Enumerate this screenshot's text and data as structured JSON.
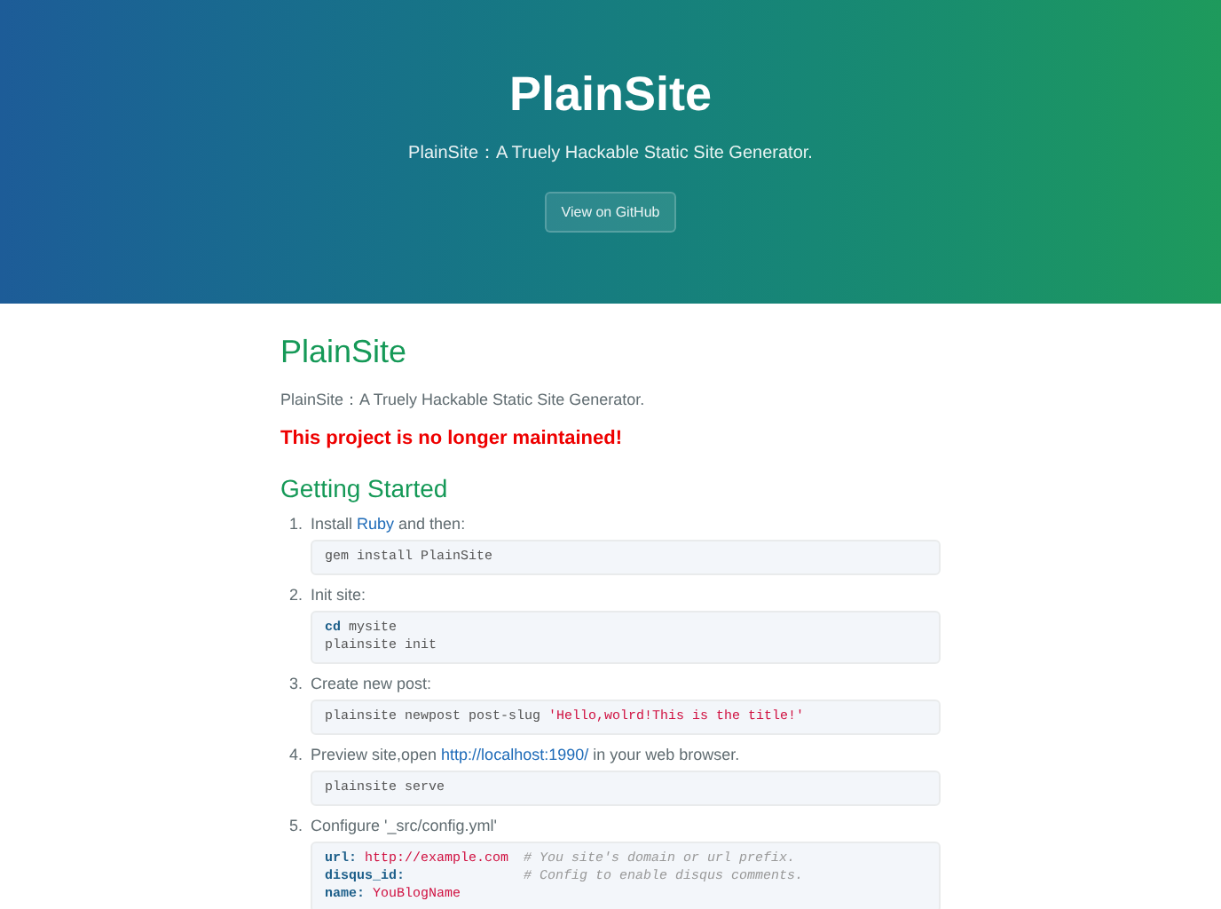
{
  "header": {
    "title": "PlainSite",
    "tagline": "PlainSite：A Truely Hackable Static Site Generator.",
    "button": "View on GitHub"
  },
  "main": {
    "title": "PlainSite",
    "intro": "PlainSite：A Truely Hackable Static Site Generator.",
    "warning": "This project is no longer maintained!",
    "section_title": "Getting Started",
    "steps": [
      {
        "number": "1.",
        "parts": [
          {
            "kind": "text",
            "text": "Install "
          },
          {
            "kind": "link",
            "text": "Ruby"
          },
          {
            "kind": "text",
            "text": " and then:"
          }
        ],
        "code": [
          [
            {
              "kind": "plain",
              "text": "gem install PlainSite"
            }
          ]
        ]
      },
      {
        "number": "2.",
        "parts": [
          {
            "kind": "text",
            "text": "Init site:"
          }
        ],
        "code": [
          [
            {
              "kind": "keyword",
              "text": "cd"
            },
            {
              "kind": "plain",
              "text": " mysite"
            }
          ],
          [
            {
              "kind": "plain",
              "text": "plainsite init"
            }
          ]
        ]
      },
      {
        "number": "3.",
        "parts": [
          {
            "kind": "text",
            "text": "Create new post:"
          }
        ],
        "code": [
          [
            {
              "kind": "plain",
              "text": "plainsite newpost post-slug "
            },
            {
              "kind": "string",
              "text": "'Hello,wolrd!This is the title!'"
            }
          ]
        ]
      },
      {
        "number": "4.",
        "parts": [
          {
            "kind": "text",
            "text": "Preview site,open "
          },
          {
            "kind": "link",
            "text": "http://localhost:1990/"
          },
          {
            "kind": "text",
            "text": " in your web browser."
          }
        ],
        "code": [
          [
            {
              "kind": "plain",
              "text": "plainsite serve"
            }
          ]
        ]
      },
      {
        "number": "5.",
        "parts": [
          {
            "kind": "text",
            "text": "Configure '_src/config.yml'"
          }
        ],
        "code": [
          [
            {
              "kind": "key",
              "text": "url:"
            },
            {
              "kind": "string",
              "text": " http://example.com"
            },
            {
              "kind": "comment",
              "text": "# You site's domain or url prefix."
            }
          ],
          [
            {
              "kind": "key",
              "text": "disqus_id:"
            },
            {
              "kind": "comment",
              "text": "# Config to enable disqus comments."
            }
          ],
          [
            {
              "kind": "key",
              "text": "name:"
            },
            {
              "kind": "string",
              "text": " YouBlogName"
            }
          ]
        ]
      }
    ]
  }
}
